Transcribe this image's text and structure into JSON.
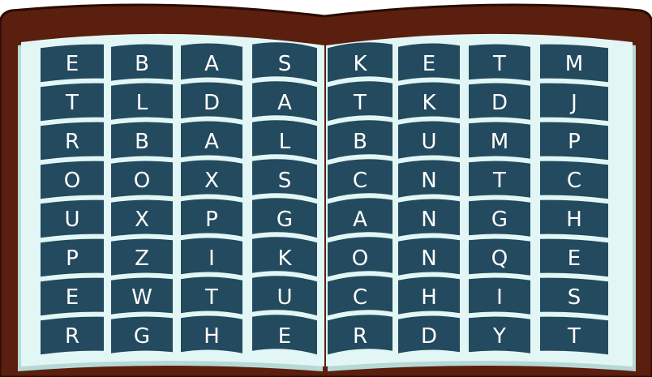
{
  "colors": {
    "cover": "#5a1f0e",
    "cover_edge": "#2b0c05",
    "page": "#e2f7f5",
    "page_shadow": "#b7d9d6",
    "tile": "#234a5e",
    "tile_text": "#ffffff"
  },
  "left_page": {
    "rows": [
      [
        "E",
        "B",
        "A",
        "S"
      ],
      [
        "T",
        "L",
        "D",
        "A"
      ],
      [
        "R",
        "B",
        "A",
        "L"
      ],
      [
        "O",
        "O",
        "X",
        "S"
      ],
      [
        "U",
        "X",
        "P",
        "G"
      ],
      [
        "P",
        "Z",
        "I",
        "K"
      ],
      [
        "E",
        "W",
        "T",
        "U"
      ],
      [
        "R",
        "G",
        "H",
        "E"
      ]
    ]
  },
  "right_page": {
    "rows": [
      [
        "K",
        "E",
        "T",
        "M"
      ],
      [
        "T",
        "K",
        "D",
        "J"
      ],
      [
        "B",
        "U",
        "M",
        "P"
      ],
      [
        "C",
        "N",
        "T",
        "C"
      ],
      [
        "A",
        "N",
        "G",
        "H"
      ],
      [
        "O",
        "N",
        "Q",
        "E"
      ],
      [
        "C",
        "H",
        "I",
        "S"
      ],
      [
        "R",
        "D",
        "Y",
        "T"
      ]
    ]
  }
}
